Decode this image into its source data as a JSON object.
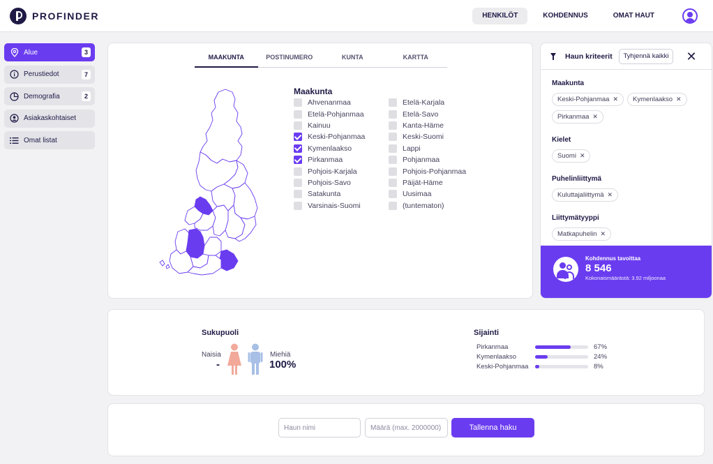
{
  "app": {
    "brand": "PROFINDER"
  },
  "header": {
    "nav": [
      {
        "label": "HENKILÖT",
        "active": true
      },
      {
        "label": "KOHDENNUS",
        "active": false
      },
      {
        "label": "OMAT HAUT",
        "active": false
      }
    ]
  },
  "sidebar": {
    "items": [
      {
        "label": "Alue",
        "badge": "3",
        "icon": "location-pin-icon",
        "active": true
      },
      {
        "label": "Perustiedot",
        "badge": "7",
        "icon": "info-icon",
        "active": false
      },
      {
        "label": "Demografia",
        "badge": "2",
        "icon": "pie-chart-icon",
        "active": false
      },
      {
        "label": "Asiakaskohtaiset",
        "badge": "",
        "icon": "user-circle-icon",
        "active": false
      },
      {
        "label": "Omat listat",
        "badge": "",
        "icon": "list-icon",
        "active": false
      }
    ]
  },
  "area": {
    "tabs": [
      {
        "label": "MAAKUNTA",
        "active": true
      },
      {
        "label": "POSTINUMERO",
        "active": false
      },
      {
        "label": "KUNTA",
        "active": false
      },
      {
        "label": "KARTTA",
        "active": false
      }
    ],
    "list_title": "Maakunta",
    "col1": [
      {
        "label": "Ahvenanmaa",
        "checked": false
      },
      {
        "label": "Etelä-Pohjanmaa",
        "checked": false
      },
      {
        "label": "Kainuu",
        "checked": false
      },
      {
        "label": "Keski-Pohjanmaa",
        "checked": true
      },
      {
        "label": "Kymenlaakso",
        "checked": true
      },
      {
        "label": "Pirkanmaa",
        "checked": true
      },
      {
        "label": "Pohjois-Karjala",
        "checked": false
      },
      {
        "label": "Pohjois-Savo",
        "checked": false
      },
      {
        "label": "Satakunta",
        "checked": false
      },
      {
        "label": "Varsinais-Suomi",
        "checked": false
      }
    ],
    "col2": [
      {
        "label": "Etelä-Karjala",
        "checked": false
      },
      {
        "label": "Etelä-Savo",
        "checked": false
      },
      {
        "label": "Kanta-Häme",
        "checked": false
      },
      {
        "label": "Keski-Suomi",
        "checked": false
      },
      {
        "label": "Lappi",
        "checked": false
      },
      {
        "label": "Pohjanmaa",
        "checked": false
      },
      {
        "label": "Pohjois-Pohjanmaa",
        "checked": false
      },
      {
        "label": "Päijät-Häme",
        "checked": false
      },
      {
        "label": "Uusimaa",
        "checked": false
      },
      {
        "label": "(tuntematon)",
        "checked": false
      }
    ],
    "map_colors": {
      "stroke": "#6a3cf0",
      "selected": "#6a3cf0",
      "fill": "#ffffff"
    }
  },
  "criteria": {
    "title": "Haun kriteerit",
    "clear_label": "Tyhjennä kaikki",
    "sections": [
      {
        "title": "Maakunta",
        "chips": [
          "Keski-Pohjanmaa",
          "Kymenlaakso",
          "Pirkanmaa"
        ]
      },
      {
        "title": "Kielet",
        "chips": [
          "Suomi"
        ]
      },
      {
        "title": "Puhelinliittymä",
        "chips": [
          "Kuluttajaliittymä"
        ]
      },
      {
        "title": "Liittymätyyppi",
        "chips": [
          "Matkapuhelin"
        ]
      }
    ],
    "reach": {
      "label": "Kohdennus tavoittaa",
      "value": "8 546",
      "sub": "Kokonaismäärästä: 3.92 miljoonaa"
    }
  },
  "gender": {
    "title": "Sukupuoli",
    "female_label": "Naisia",
    "female_value": "-",
    "male_label": "Miehiä",
    "male_value": "100%",
    "female_color": "#f2a99a",
    "male_color": "#a8bfe6"
  },
  "location": {
    "title": "Sijainti",
    "rows": [
      {
        "name": "Pirkanmaa",
        "percent_label": "67%",
        "percent": 67
      },
      {
        "name": "Kymenlaakso",
        "percent_label": "24%",
        "percent": 24
      },
      {
        "name": "Keski-Pohjanmaa",
        "percent_label": "8%",
        "percent": 8
      }
    ]
  },
  "save": {
    "name_placeholder": "Haun nimi",
    "amount_placeholder": "Määrä (max. 2000000)",
    "button_label": "Tallenna haku"
  },
  "colors": {
    "accent": "#6a3cf0",
    "brand": "#1f1a45"
  }
}
